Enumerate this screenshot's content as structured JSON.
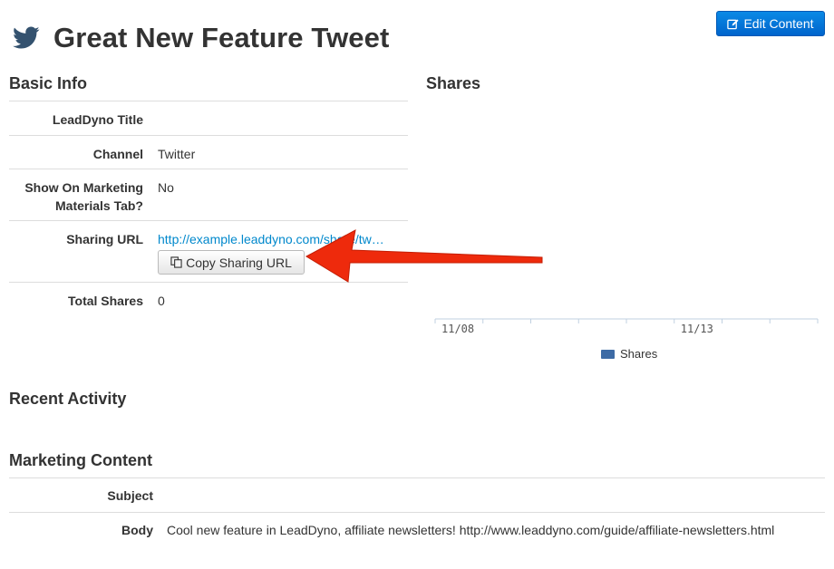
{
  "header": {
    "title": "Great New Feature Tweet",
    "icon": "twitter-icon",
    "edit_button": "Edit Content",
    "brand_color": "#34526f"
  },
  "basic_info": {
    "heading": "Basic Info",
    "rows": [
      {
        "label": "LeadDyno Title",
        "value": ""
      },
      {
        "label": "Channel",
        "value": "Twitter"
      },
      {
        "label": "Show On Marketing Materials Tab?",
        "value": "No"
      },
      {
        "label": "Sharing URL",
        "value": "http://example.leaddyno.com/share/tw…"
      },
      {
        "label": "Total Shares",
        "value": "0"
      }
    ],
    "copy_button": "Copy Sharing URL"
  },
  "shares": {
    "heading": "Shares",
    "chart_data": {
      "type": "bar",
      "categories": [
        "11/08",
        "11/13"
      ],
      "series": [
        {
          "name": "Shares",
          "values": [
            0,
            0
          ]
        }
      ],
      "color": "#3d6ba5"
    }
  },
  "recent_activity": {
    "heading": "Recent Activity"
  },
  "marketing_content": {
    "heading": "Marketing Content",
    "rows": [
      {
        "label": "Subject",
        "value": ""
      },
      {
        "label": "Body",
        "value": "Cool new feature in LeadDyno, affiliate newsletters!  http://www.leaddyno.com/guide/affiliate-newsletters.html"
      }
    ]
  },
  "annotation_color": "#ee2a0c"
}
